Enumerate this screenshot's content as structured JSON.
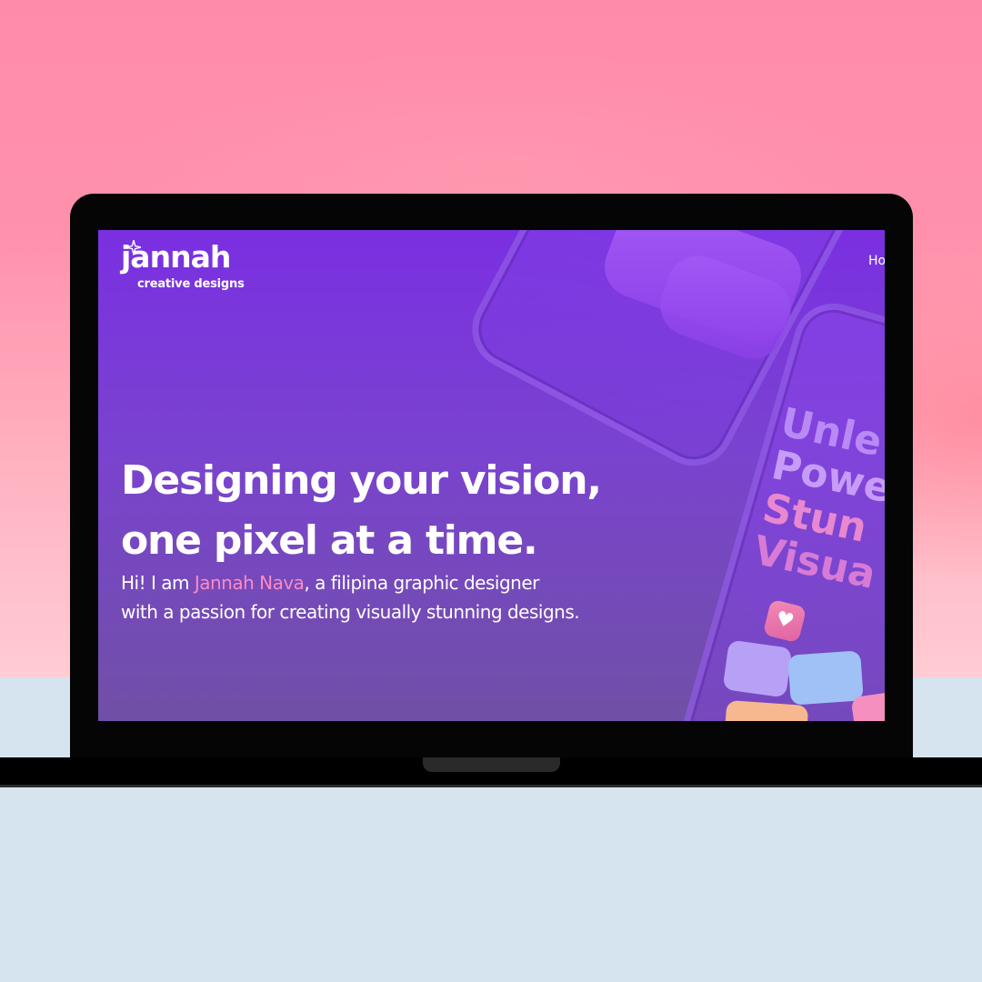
{
  "site": {
    "logo": {
      "word": "jannah",
      "tagline": "creative designs"
    },
    "nav": {
      "home_label": "Ho"
    },
    "hero": {
      "headline_line1": "Designing your vision,",
      "headline_line2": "one pixel at a time.",
      "intro_prefix": "Hi! I am ",
      "intro_name": "Jannah Nava",
      "intro_suffix_line1": ", a filipina graphic designer",
      "intro_line2": "with a passion for creating visually stunning designs."
    },
    "artwork": {
      "promo_lines": [
        "Unle",
        "Powe",
        "Stun",
        "Visua"
      ],
      "heart_icon": "heart-icon"
    }
  },
  "colors": {
    "background_pink": "#ff8bab",
    "background_blue": "#d6e4ef",
    "screen_top": "#7a2fe1",
    "screen_bottom": "#7050a6",
    "name_highlight": "#ff8ac0",
    "laptop_frame": "#050505"
  }
}
